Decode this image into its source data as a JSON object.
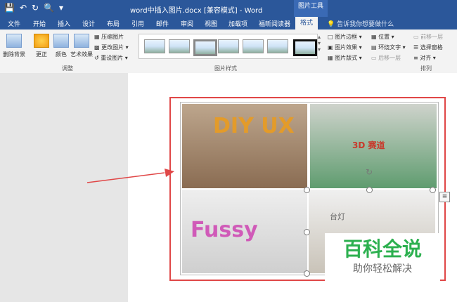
{
  "window": {
    "title": "word中插入图片.docx [兼容模式] - Word",
    "context_tool": "图片工具"
  },
  "quick_access": [
    "save-icon",
    "undo-icon",
    "redo-icon",
    "print-preview-icon",
    "customize-icon"
  ],
  "tabs": [
    "文件",
    "开始",
    "插入",
    "设计",
    "布局",
    "引用",
    "邮件",
    "审阅",
    "视图",
    "加载项",
    "福昕阅读器",
    "格式"
  ],
  "active_tab": "格式",
  "tell_me": "告诉我你想要做什么",
  "ribbon": {
    "remove_bg": "删除背景",
    "correct": "更正",
    "color": "颜色",
    "artistic": "艺术效果",
    "compress": "压缩图片",
    "change": "更改图片",
    "reset": "重设图片",
    "group_adjust": "调整",
    "group_styles": "图片样式",
    "border": "图片边框",
    "effects": "图片效果",
    "layout": "图片版式",
    "position": "位置",
    "wrap": "环绕文字",
    "forward": "前移一层",
    "backward": "后移一层",
    "select_pane": "选择窗格",
    "align": "对齐",
    "group_arrange": "排列"
  },
  "photos": [
    "DIY UX",
    "3D 赛道",
    "Fussy",
    "台灯"
  ],
  "watermark": {
    "line1": "百科全说",
    "line2": "助你轻松解决"
  },
  "colors": {
    "title_bar": "#2b579a",
    "annotation_red": "#e04747",
    "watermark_green": "#2cb04f"
  }
}
